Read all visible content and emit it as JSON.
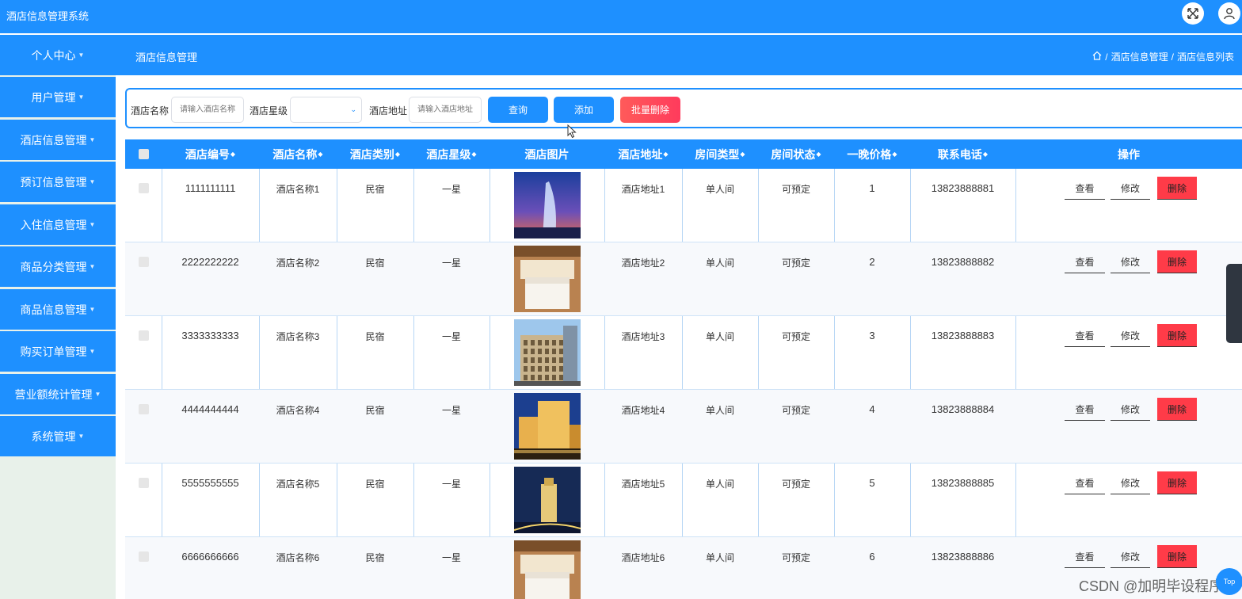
{
  "app": {
    "title": "酒店信息管理系统"
  },
  "topbar_icons": [
    "fullscreen-icon",
    "user-icon"
  ],
  "sidebar": {
    "items": [
      {
        "label": "个人中心"
      },
      {
        "label": "用户管理"
      },
      {
        "label": "酒店信息管理"
      },
      {
        "label": "预订信息管理"
      },
      {
        "label": "入住信息管理"
      },
      {
        "label": "商品分类管理"
      },
      {
        "label": "商品信息管理"
      },
      {
        "label": "购买订单管理"
      },
      {
        "label": "营业额统计管理"
      },
      {
        "label": "系统管理"
      }
    ]
  },
  "header": {
    "page_title": "酒店信息管理",
    "breadcrumb": [
      "酒店信息管理",
      "酒店信息列表"
    ]
  },
  "search": {
    "name_label": "酒店名称",
    "name_placeholder": "请输入酒店名称",
    "star_label": "酒店星级",
    "star_value": "",
    "address_label": "酒店地址",
    "address_placeholder": "请输入酒店地址",
    "query_label": "查询",
    "add_label": "添加",
    "batch_delete_label": "批量删除"
  },
  "table": {
    "columns": [
      "酒店编号",
      "酒店名称",
      "酒店类别",
      "酒店星级",
      "酒店图片",
      "酒店地址",
      "房间类型",
      "房间状态",
      "一晚价格",
      "联系电话",
      "操作"
    ],
    "actions": {
      "view": "查看",
      "edit": "修改",
      "delete": "删除"
    },
    "rows": [
      {
        "id": "1111111111",
        "name": "酒店名称1",
        "category": "民宿",
        "star": "一星",
        "image": "burj-tower-dusk",
        "address": "酒店地址1",
        "room_type": "单人间",
        "status": "可预定",
        "price": "1",
        "phone": "13823888881"
      },
      {
        "id": "2222222222",
        "name": "酒店名称2",
        "category": "民宿",
        "star": "一星",
        "image": "wooden-bedroom",
        "address": "酒店地址2",
        "room_type": "单人间",
        "status": "可预定",
        "price": "2",
        "phone": "13823888882"
      },
      {
        "id": "3333333333",
        "name": "酒店名称3",
        "category": "民宿",
        "star": "一星",
        "image": "classic-building-day",
        "address": "酒店地址3",
        "room_type": "单人间",
        "status": "可预定",
        "price": "3",
        "phone": "13823888883"
      },
      {
        "id": "4444444444",
        "name": "酒店名称4",
        "category": "民宿",
        "star": "一星",
        "image": "casino-night",
        "address": "酒店地址4",
        "room_type": "单人间",
        "status": "可预定",
        "price": "4",
        "phone": "13823888884"
      },
      {
        "id": "5555555555",
        "name": "酒店名称5",
        "category": "民宿",
        "star": "一星",
        "image": "tower-night",
        "address": "酒店地址5",
        "room_type": "单人间",
        "status": "可预定",
        "price": "5",
        "phone": "13823888885"
      },
      {
        "id": "6666666666",
        "name": "酒店名称6",
        "category": "民宿",
        "star": "一星",
        "image": "wooden-bedroom",
        "address": "酒店地址6",
        "room_type": "单人间",
        "status": "可预定",
        "price": "6",
        "phone": "13823888886"
      }
    ]
  },
  "watermark": "CSDN @加明毕设程序",
  "back_to_top": "Top",
  "colors": {
    "primary": "#1e90ff",
    "danger": "#ff3b48",
    "sidebar_bg": "#e8f1ea"
  }
}
